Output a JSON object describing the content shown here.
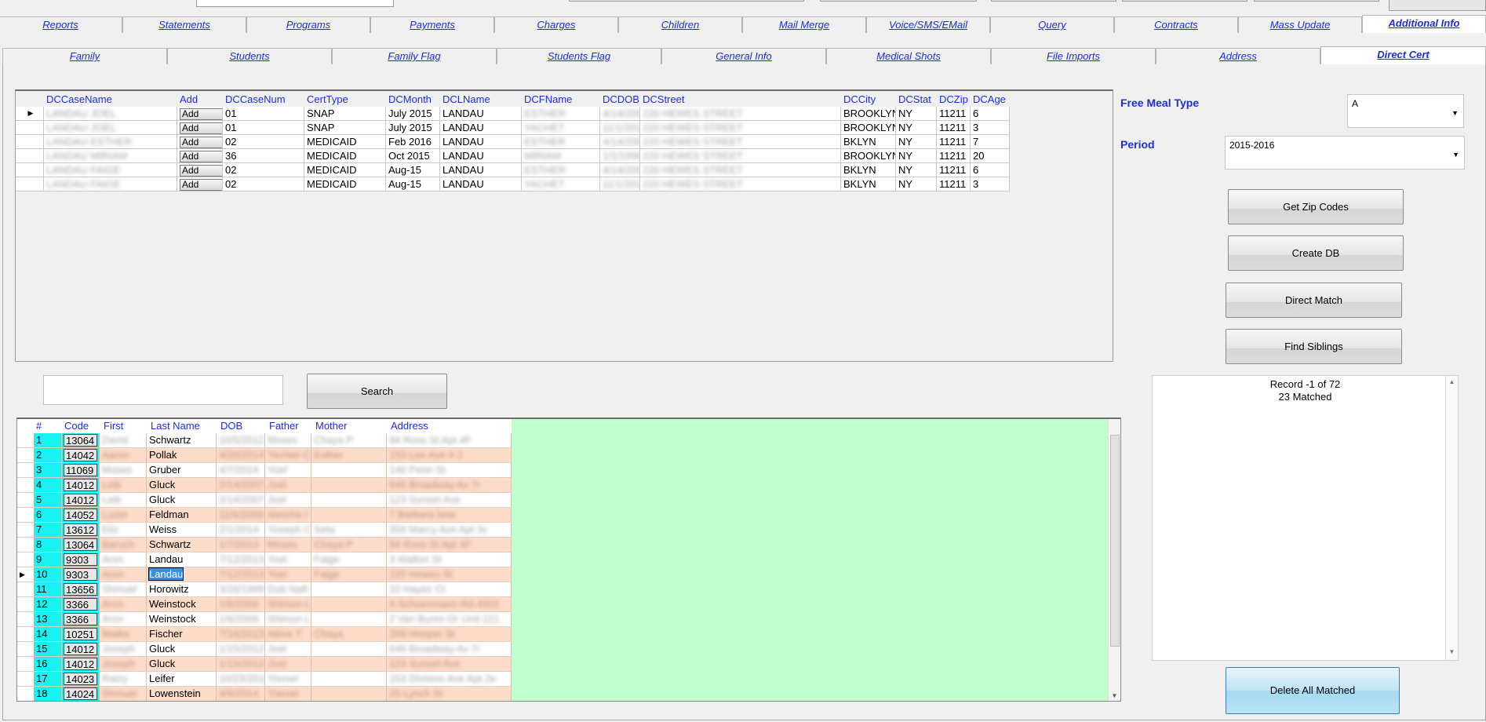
{
  "main_tabs": [
    {
      "label": "Reports",
      "active": false
    },
    {
      "label": "Statements",
      "active": false
    },
    {
      "label": "Programs",
      "active": false
    },
    {
      "label": "Payments",
      "active": false
    },
    {
      "label": "Charges",
      "active": false
    },
    {
      "label": "Children",
      "active": false
    },
    {
      "label": "Mail Merge",
      "active": false
    },
    {
      "label": "Voice/SMS/EMail",
      "active": false
    },
    {
      "label": "Query",
      "active": false
    },
    {
      "label": "Contracts",
      "active": false
    },
    {
      "label": "Mass Update",
      "active": false
    },
    {
      "label": "Additional Info",
      "active": true
    }
  ],
  "sub_tabs": [
    {
      "label": "Family",
      "active": false
    },
    {
      "label": "Students",
      "active": false
    },
    {
      "label": "Family Flag",
      "active": false
    },
    {
      "label": "Students Flag",
      "active": false
    },
    {
      "label": "General Info",
      "active": false
    },
    {
      "label": "Medical Shots",
      "active": false
    },
    {
      "label": "File Imports",
      "active": false
    },
    {
      "label": "Address",
      "active": false
    },
    {
      "label": "Direct Cert",
      "active": true
    }
  ],
  "dc_grid": {
    "columns": [
      "DCCaseName",
      "Add",
      "DCCaseNum",
      "CertType",
      "DCMonth",
      "DCLName",
      "DCFName",
      "DCDOB",
      "DCStreet",
      "DCCity",
      "DCStat",
      "DCZip",
      "DCAge"
    ],
    "add_label": "Add",
    "rows": [
      {
        "name": "LANDAU JOEL",
        "num": "01",
        "cert": "SNAP",
        "month": "July 2015",
        "lname": "LANDAU",
        "fname": "ESTHER",
        "dob": "4/14/2005",
        "street": "220 HEWES STREET",
        "city": "BROOKLYN",
        "stat": "NY",
        "zip": "11211",
        "age": "6"
      },
      {
        "name": "LANDAU JOEL",
        "num": "01",
        "cert": "SNAP",
        "month": "July 2015",
        "lname": "LANDAU",
        "fname": "YACHET",
        "dob": "11/1/2011",
        "street": "220 HEWES STREET",
        "city": "BROOKLYN",
        "stat": "NY",
        "zip": "11211",
        "age": "3"
      },
      {
        "name": "LANDAU ESTHER",
        "num": "02",
        "cert": "MEDICAID",
        "month": "Feb 2016",
        "lname": "LANDAU",
        "fname": "ESTHER",
        "dob": "4/14/2005",
        "street": "220 HEWES STREET",
        "city": "BKLYN",
        "stat": "NY",
        "zip": "11211",
        "age": "7"
      },
      {
        "name": "LANDAU MIRIAM",
        "num": "36",
        "cert": "MEDICAID",
        "month": "Oct 2015",
        "lname": "LANDAU",
        "fname": "MIRIAM",
        "dob": "1/1/1996",
        "street": "220 HEWES STREET",
        "city": "BROOKLYN",
        "stat": "NY",
        "zip": "11211",
        "age": "20"
      },
      {
        "name": "LANDAU FAIGE",
        "num": "02",
        "cert": "MEDICAID",
        "month": "Aug-15",
        "lname": "LANDAU",
        "fname": "ESTHER",
        "dob": "4/14/2005",
        "street": "220 HEWES STREET",
        "city": "BKLYN",
        "stat": "NY",
        "zip": "11211",
        "age": "6"
      },
      {
        "name": "LANDAU FAIGE",
        "num": "02",
        "cert": "MEDICAID",
        "month": "Aug-15",
        "lname": "LANDAU",
        "fname": "YACHET",
        "dob": "11/1/2011",
        "street": "220 HEWES STREET",
        "city": "BKLYN",
        "stat": "NY",
        "zip": "11211",
        "age": "3"
      }
    ]
  },
  "right_panel": {
    "free_meal_label": "Free Meal Type",
    "free_meal_value": "A",
    "period_label": "Period",
    "period_value": "2015-2016",
    "btn_zip": "Get Zip Codes",
    "btn_create": "Create DB",
    "btn_direct": "Direct Match",
    "btn_siblings": "Find Siblings",
    "record_text": "Record -1 of 72",
    "matched_text": "23 Matched",
    "btn_delete": "Delete All Matched"
  },
  "search": {
    "value": "",
    "button": "Search"
  },
  "student_grid": {
    "columns": [
      "#",
      "Code",
      "First",
      "Last Name",
      "DOB",
      "Father",
      "Mother",
      "Address"
    ],
    "rows": [
      {
        "n": "1",
        "code": "13064",
        "first": "David",
        "last": "Schwartz",
        "dob": "10/5/2012",
        "father": "Moses",
        "mother": "Chaya P",
        "addr": "94 Ross St Apt 4F"
      },
      {
        "n": "2",
        "code": "14042",
        "first": "Aaron",
        "last": "Pollak",
        "dob": "4/20/2014",
        "father": "Yechiel C",
        "mother": "Esther",
        "addr": "153 Lee Ave # 2"
      },
      {
        "n": "3",
        "code": "11069",
        "first": "Moses",
        "last": "Gruber",
        "dob": "4/7/2014",
        "father": "Yoel",
        "mother": "",
        "addr": "146 Penn St"
      },
      {
        "n": "4",
        "code": "14012",
        "first": "Leib",
        "last": "Gluck",
        "dob": "2/14/2007",
        "father": "Joel",
        "mother": "",
        "addr": "646 Broadway Av 7r"
      },
      {
        "n": "5",
        "code": "14012",
        "first": "Leib",
        "last": "Gluck",
        "dob": "2/14/2007",
        "father": "Joel",
        "mother": "",
        "addr": "123 Sunset Ave"
      },
      {
        "n": "6",
        "code": "14052",
        "first": "Luzer",
        "last": "Feldman",
        "dob": "11/6/2009",
        "father": "Simcha I",
        "mother": "",
        "addr": "7 Barbara lane"
      },
      {
        "n": "7",
        "code": "13612",
        "first": "Eliz",
        "last": "Weiss",
        "dob": "2/1/2014",
        "father": "Yoseph C",
        "mother": "Seta",
        "addr": "358 Marcy Ave Apt 3c"
      },
      {
        "n": "8",
        "code": "13064",
        "first": "Baruch",
        "last": "Schwartz",
        "dob": "1/7/2013",
        "father": "Moses",
        "mother": "Chaya P",
        "addr": "94 Ross St Apt 4F"
      },
      {
        "n": "9",
        "code": "9303",
        "first": "Aron",
        "last": "Landau",
        "dob": "7/12/2013",
        "father": "Yoel",
        "mother": "Faige",
        "addr": "3 Walton St"
      },
      {
        "n": "10",
        "code": "9303",
        "first": "Aron",
        "last": "Landau",
        "dob": "7/12/2013",
        "father": "Yoel",
        "mother": "Faige",
        "addr": "220 Hewes St"
      },
      {
        "n": "11",
        "code": "13656",
        "first": "Shmuel",
        "last": "Horowitz",
        "dob": "3/26/1999",
        "father": "Dub Naft",
        "mother": "",
        "addr": "10 Hayes Ct"
      },
      {
        "n": "12",
        "code": "3366",
        "first": "Aron",
        "last": "Weinstock",
        "dob": "1/6/2006",
        "father": "Shimon L",
        "mother": "",
        "addr": "4 Schoenmann Rd 4002"
      },
      {
        "n": "13",
        "code": "3366",
        "first": "Aron",
        "last": "Weinstock",
        "dob": "1/6/2006",
        "father": "Shimon L",
        "mother": "",
        "addr": "2 Van Buren Dr Unit 221"
      },
      {
        "n": "14",
        "code": "10251",
        "first": "Malka",
        "last": "Fischer",
        "dob": "7/16/2013",
        "father": "Akiva Y",
        "mother": "Chaya",
        "addr": "299 Hooper St"
      },
      {
        "n": "15",
        "code": "14012",
        "first": "Joseph",
        "last": "Gluck",
        "dob": "1/15/2012",
        "father": "Joel",
        "mother": "",
        "addr": "646 Broadway Av 7r"
      },
      {
        "n": "16",
        "code": "14012",
        "first": "Joseph",
        "last": "Gluck",
        "dob": "1/15/2012",
        "father": "Joel",
        "mother": "",
        "addr": "123 Sunset Ave"
      },
      {
        "n": "17",
        "code": "14023",
        "first": "Raizy",
        "last": "Leifer",
        "dob": "10/23/2011",
        "father": "Yisroel",
        "mother": "",
        "addr": "153 Division Ave Apt 2e"
      },
      {
        "n": "18",
        "code": "14024",
        "first": "Shmuel",
        "last": "Lowenstein",
        "dob": "4/6/2014",
        "father": "Yisroel",
        "mother": "",
        "addr": "26 Lynch St"
      }
    ]
  },
  "colors": {
    "accent_blue": "#1e2fd4",
    "row_cyan": "#19f2f2",
    "row_peach": "#fddcca",
    "empty_area": "#c1ffd1",
    "selection": "#3b8ee0"
  }
}
